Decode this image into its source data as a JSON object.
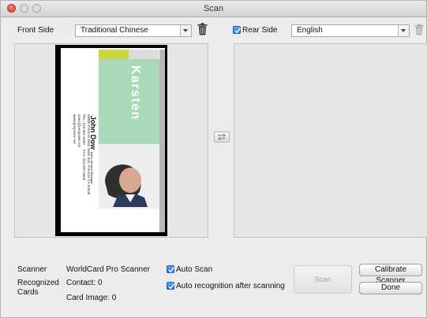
{
  "window": {
    "title": "Scan"
  },
  "front": {
    "label": "Front Side",
    "language": "Traditional Chinese"
  },
  "rear": {
    "checkbox_label": "Rear Side",
    "checked": true,
    "language": "English"
  },
  "card": {
    "brand": "Karsten",
    "name": "John Dow",
    "job_title": "Sales Section Manager",
    "address": "46800 Fremont Blvd. Suite 810, Fremont CA 94538",
    "phone": "TEL: 510-987-6600",
    "fax": "FAX: 510-987-6606",
    "email": "sales@penpower.net",
    "web": "www.penpower.net"
  },
  "footer": {
    "scanner_label": "Scanner",
    "scanner_value": "WorldCard Pro Scanner",
    "recognized_label": "Recognized Cards",
    "contact": "Contact:  0",
    "card_image": "Card Image:  0",
    "auto_scan_label": "Auto Scan",
    "auto_scan_checked": true,
    "auto_recog_label": "Auto recognition after scanning",
    "auto_recog_checked": true,
    "scan_button": "Scan",
    "calibrate_button": "Calibrate Scanner",
    "done_button": "Done"
  },
  "colors": {
    "accent": "#2a7be4",
    "card_green": "#a9d9b9",
    "card_lime": "#c8d640"
  }
}
